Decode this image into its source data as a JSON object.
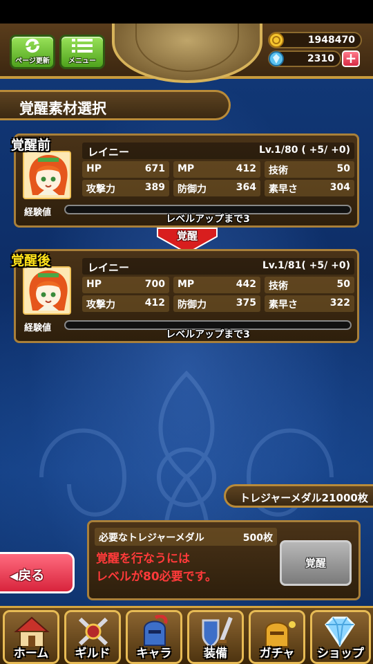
{
  "header": {
    "refresh_label": "ページ更新",
    "menu_label": "メニュー",
    "coins": "1948470",
    "gems": "2310",
    "plus_label": "+"
  },
  "title": "覚醒素材選択",
  "before": {
    "tag": "覚醒前",
    "name": "レイニー",
    "level": "Lv.1/80 ( +5/ +0)",
    "stats": [
      {
        "k": "HP",
        "v": "671"
      },
      {
        "k": "MP",
        "v": "412"
      },
      {
        "k": "技術",
        "v": "50"
      },
      {
        "k": "攻撃力",
        "v": "389"
      },
      {
        "k": "防御力",
        "v": "364"
      },
      {
        "k": "素早さ",
        "v": "304"
      }
    ],
    "exp_label": "経験値",
    "exp_text": "レベルアップまで3"
  },
  "arrow_label": "覚醒",
  "after": {
    "tag": "覚醒後",
    "name": "レイニー",
    "level": "Lv.1/81( +5/ +0)",
    "stats": [
      {
        "k": "HP",
        "v": "700"
      },
      {
        "k": "MP",
        "v": "442"
      },
      {
        "k": "技術",
        "v": "50"
      },
      {
        "k": "攻撃力",
        "v": "412"
      },
      {
        "k": "防御力",
        "v": "375"
      },
      {
        "k": "素早さ",
        "v": "322"
      }
    ],
    "exp_label": "経験値",
    "exp_text": "レベルアップまで3"
  },
  "treasure_medals": "トレジャーメダル21000枚",
  "confirm": {
    "need_label": "必要なトレジャーメダル",
    "need_value": "500枚",
    "warning_line1": "覚醒を行なうには",
    "warning_line2": "レベルが80必要です。",
    "awaken_button": "覚醒"
  },
  "back_label": "戻る",
  "nav": [
    {
      "label": "ホーム",
      "icon": "home-icon"
    },
    {
      "label": "ギルド",
      "icon": "guild-icon"
    },
    {
      "label": "キャラ",
      "icon": "character-icon"
    },
    {
      "label": "装備",
      "icon": "equipment-icon"
    },
    {
      "label": "ガチャ",
      "icon": "gacha-icon"
    },
    {
      "label": "ショップ",
      "icon": "shop-icon"
    }
  ],
  "colors": {
    "background": "#123a7a",
    "panel": "#4a3318",
    "gold_border": "#a9803a",
    "before_tag": "#ffffff",
    "after_tag": "#ffe21a",
    "warning": "#ff3a3a",
    "back_button": "#e0364c"
  }
}
